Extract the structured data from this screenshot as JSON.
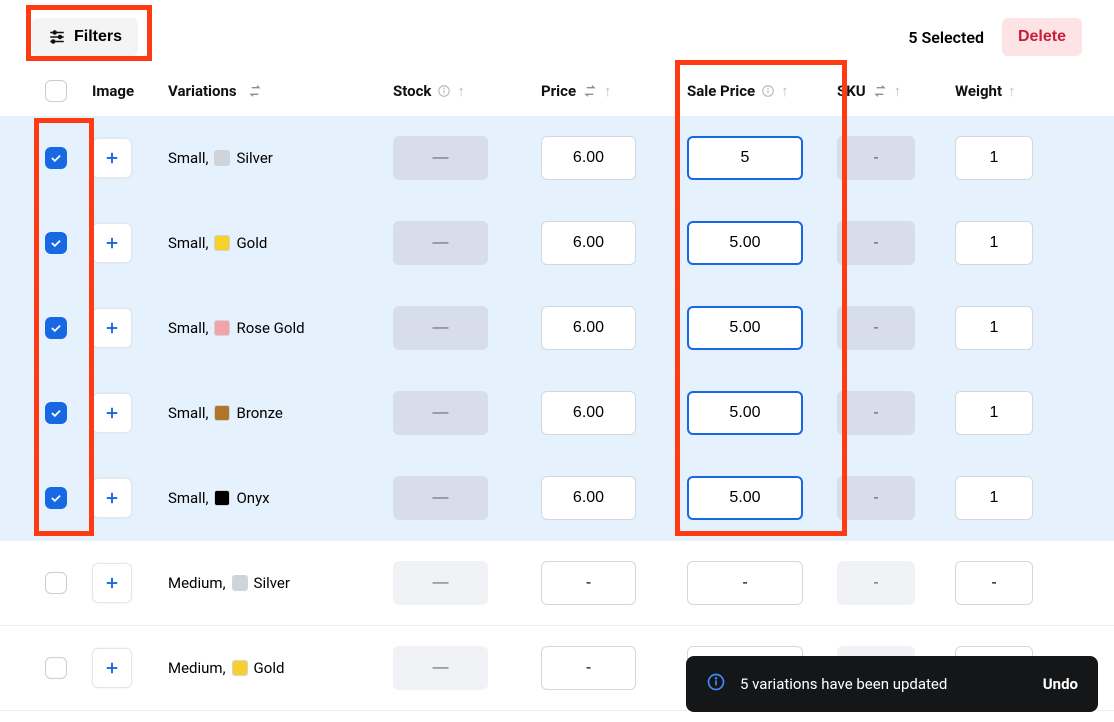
{
  "toolbar": {
    "filters_label": "Filters",
    "selected_text": "5 Selected",
    "delete_label": "Delete"
  },
  "columns": {
    "image": "Image",
    "variations": "Variations",
    "stock": "Stock",
    "price": "Price",
    "sale_price": "Sale Price",
    "sku": "SKU",
    "weight": "Weight"
  },
  "rows": [
    {
      "selected": true,
      "size": "Small",
      "color_name": "Silver",
      "swatch": "sw-silver",
      "stock": "—",
      "price": "6.00",
      "sale": "5",
      "sku": "-",
      "weight": "1"
    },
    {
      "selected": true,
      "size": "Small",
      "color_name": "Gold",
      "swatch": "sw-gold",
      "stock": "—",
      "price": "6.00",
      "sale": "5.00",
      "sku": "-",
      "weight": "1"
    },
    {
      "selected": true,
      "size": "Small",
      "color_name": "Rose Gold",
      "swatch": "sw-rose",
      "stock": "—",
      "price": "6.00",
      "sale": "5.00",
      "sku": "-",
      "weight": "1"
    },
    {
      "selected": true,
      "size": "Small",
      "color_name": "Bronze",
      "swatch": "sw-bronze",
      "stock": "—",
      "price": "6.00",
      "sale": "5.00",
      "sku": "-",
      "weight": "1"
    },
    {
      "selected": true,
      "size": "Small",
      "color_name": "Onyx",
      "swatch": "sw-onyx",
      "stock": "—",
      "price": "6.00",
      "sale": "5.00",
      "sku": "-",
      "weight": "1"
    },
    {
      "selected": false,
      "size": "Medium",
      "color_name": "Silver",
      "swatch": "sw-silver",
      "stock": "—",
      "price": "-",
      "sale": "-",
      "sku": "-",
      "weight": "-"
    },
    {
      "selected": false,
      "size": "Medium",
      "color_name": "Gold",
      "swatch": "sw-gold",
      "stock": "—",
      "price": "-",
      "sale": "-",
      "sku": "-",
      "weight": "-"
    }
  ],
  "toast": {
    "message": "5 variations have been updated",
    "undo": "Undo"
  }
}
